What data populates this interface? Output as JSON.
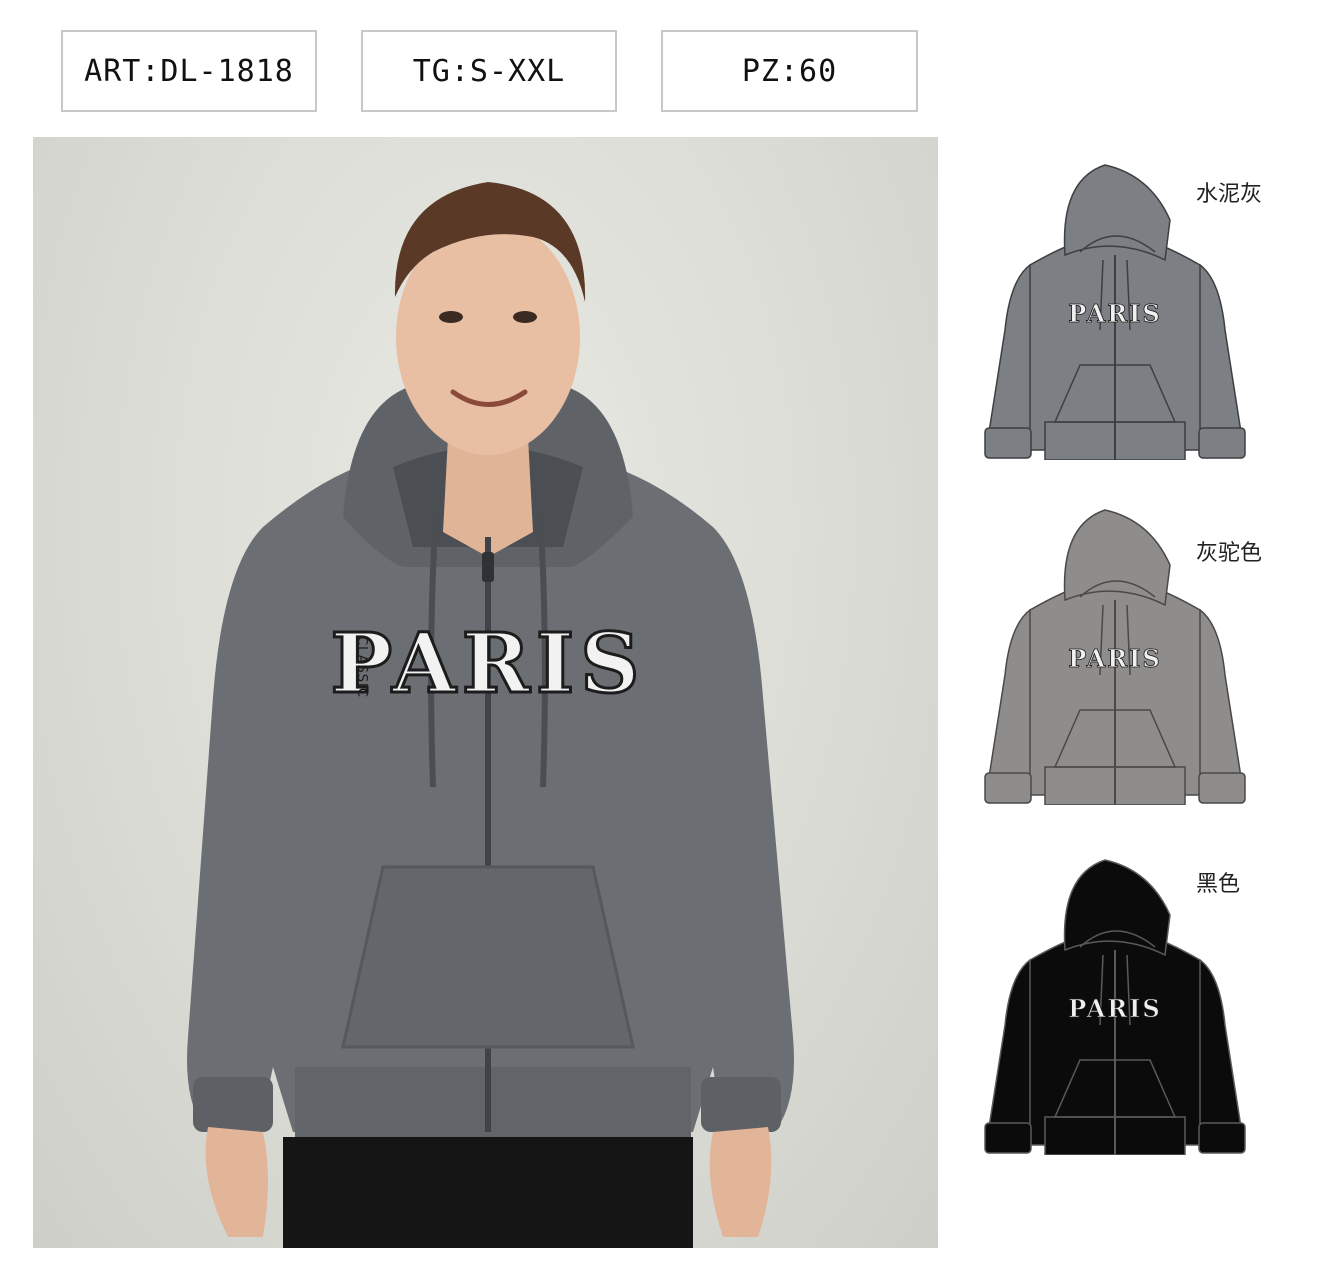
{
  "header": {
    "art": "ART:DL-1818",
    "sizes": "TG:S-XXL",
    "pieces": "PZ:60"
  },
  "product": {
    "print_text": "PARIS",
    "print_subtext": "CLASSIC"
  },
  "colors": [
    {
      "label": "水泥灰",
      "fill": "#7c7f83",
      "stroke": "#3d3f42"
    },
    {
      "label": "灰驼色",
      "fill": "#8e8d8b",
      "stroke": "#4a4948"
    },
    {
      "label": "黑色",
      "fill": "#0b0b0b",
      "stroke": "#5a5a5a"
    }
  ]
}
